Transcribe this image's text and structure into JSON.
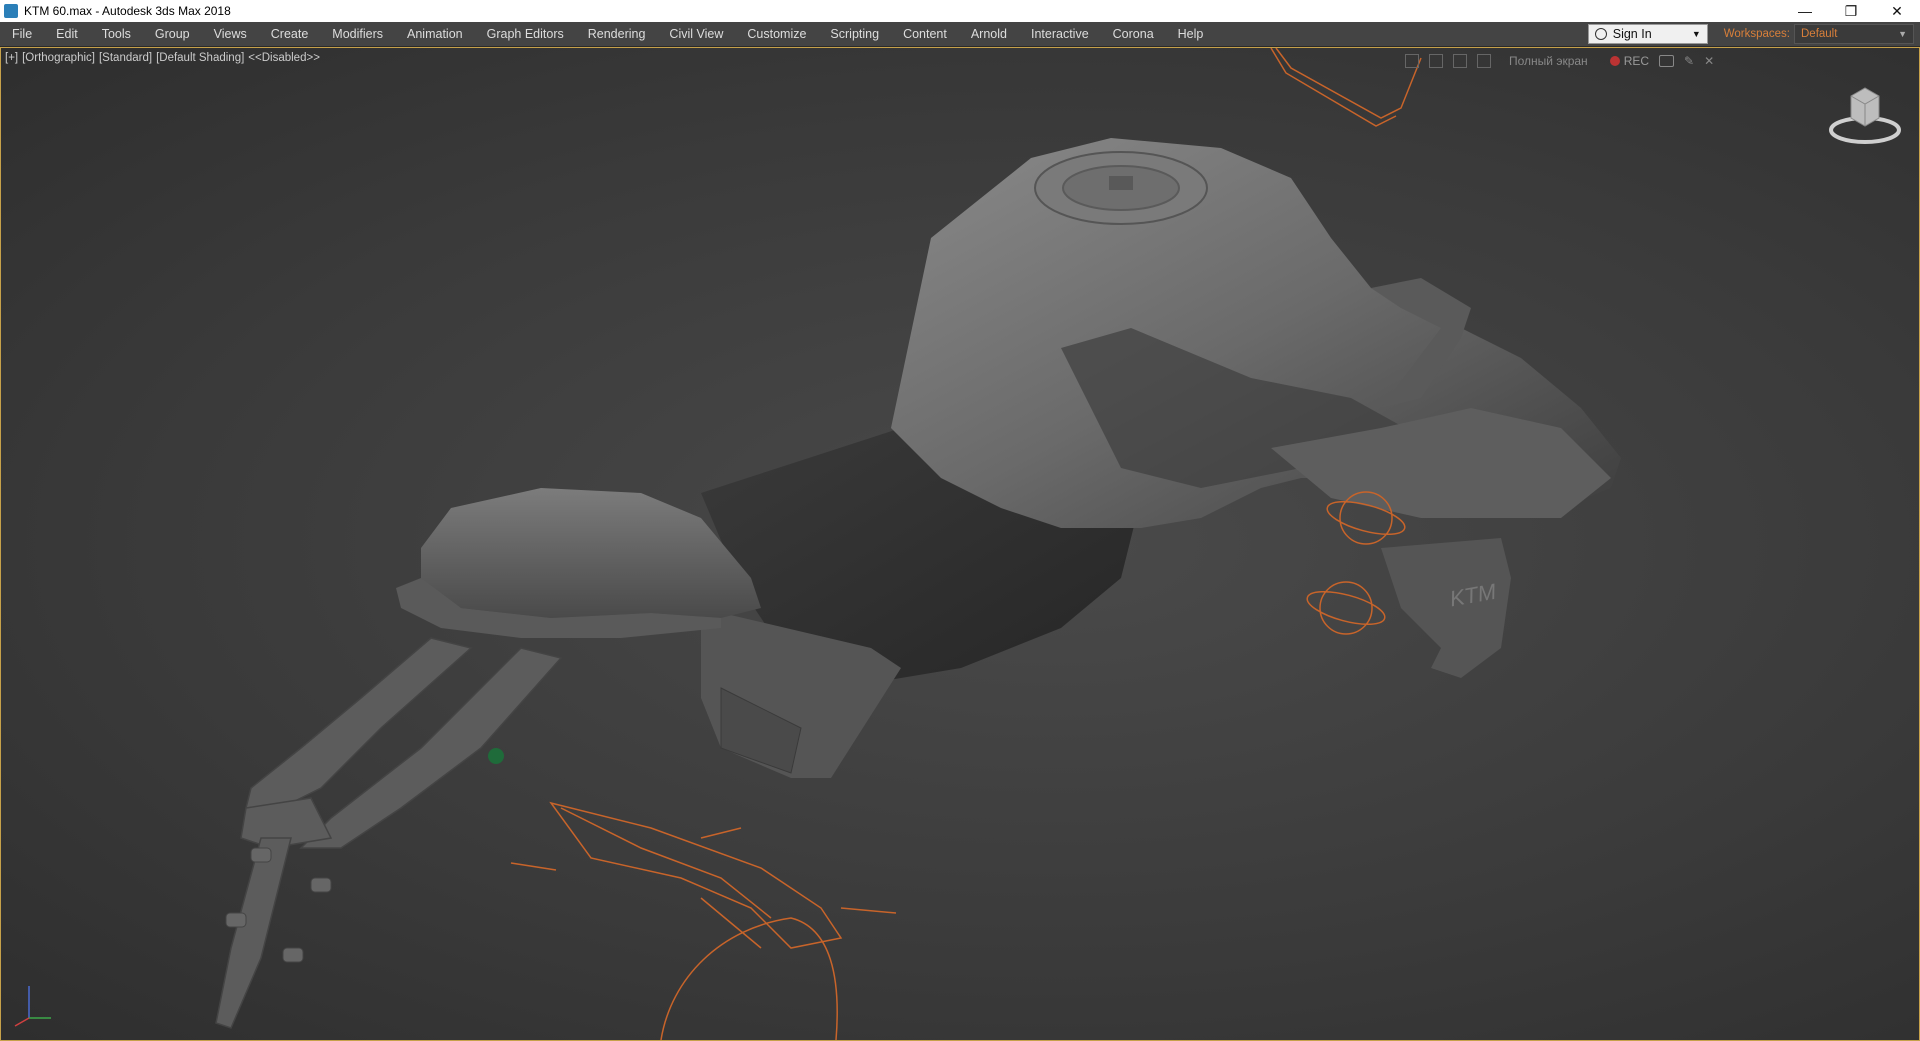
{
  "window": {
    "title": "KTM 60.max - Autodesk 3ds Max 2018",
    "controls": [
      "—",
      "❐",
      "✕"
    ]
  },
  "menu": [
    "File",
    "Edit",
    "Tools",
    "Group",
    "Views",
    "Create",
    "Modifiers",
    "Animation",
    "Graph Editors",
    "Rendering",
    "Civil View",
    "Customize",
    "Scripting",
    "Content",
    "Arnold",
    "Interactive",
    "Corona",
    "Help"
  ],
  "signin": {
    "label": "Sign In"
  },
  "workspaces": {
    "label": "Workspaces:",
    "value": "Default"
  },
  "viewport": {
    "label_plus": "[+]",
    "label_view": "[Orthographic]",
    "label_standard": "[Standard]",
    "label_shading": "[Default Shading]",
    "label_disabled": "<<Disabled>>",
    "fullscreen": "Полный экран",
    "rec": "REC"
  },
  "colors": {
    "accent": "#d87f3a",
    "viewport_border": "#c6a14a",
    "wire": "#c8642a",
    "mesh": "#6e6e6e"
  }
}
